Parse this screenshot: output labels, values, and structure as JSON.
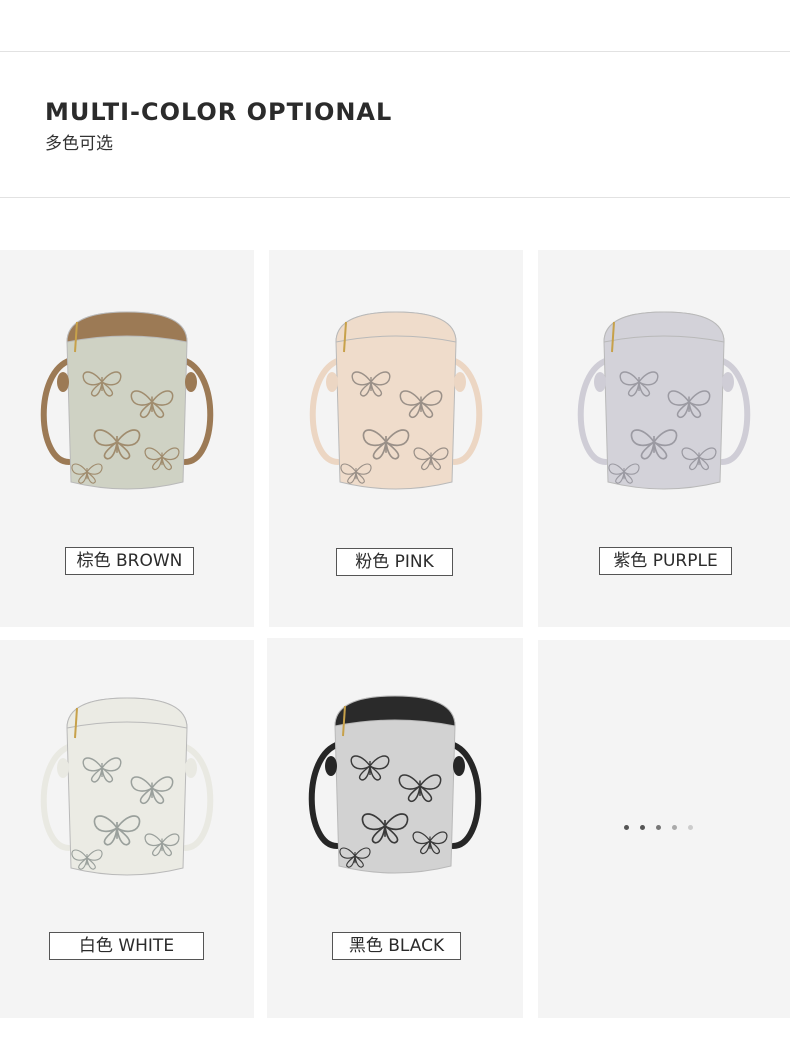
{
  "header": {
    "title": "MULTI-COLOR OPTIONAL",
    "subtitle": "多色可选"
  },
  "colors": [
    {
      "label": "棕色 BROWN",
      "body": "#cfd2c4",
      "trim": "#9c7a55",
      "strap": "#9c7a55",
      "print": "#a08c6e"
    },
    {
      "label": "粉色 PINK",
      "body": "#efdccb",
      "trim": "#efdccb",
      "strap": "#ecd6c3",
      "print": "#9a9088"
    },
    {
      "label": "紫色 PURPLE",
      "body": "#d3d2d9",
      "trim": "#d3d2d9",
      "strap": "#cfcdd6",
      "print": "#9b9aa2"
    },
    {
      "label": "白色 WHITE",
      "body": "#ebebe4",
      "trim": "#ebebe4",
      "strap": "#e9e9e2",
      "print": "#9aa09c"
    },
    {
      "label": "黑色 BLACK",
      "body": "#d2d2d2",
      "trim": "#2a2a2a",
      "strap": "#262626",
      "print": "#3a3a3a"
    }
  ],
  "more": {
    "dot_colors": [
      "#555555",
      "#555555",
      "#777777",
      "#aaaaaa",
      "#cccccc"
    ]
  },
  "icons": {
    "product": "crossbody-phone-bag-icon",
    "more": "more-dots-icon"
  }
}
